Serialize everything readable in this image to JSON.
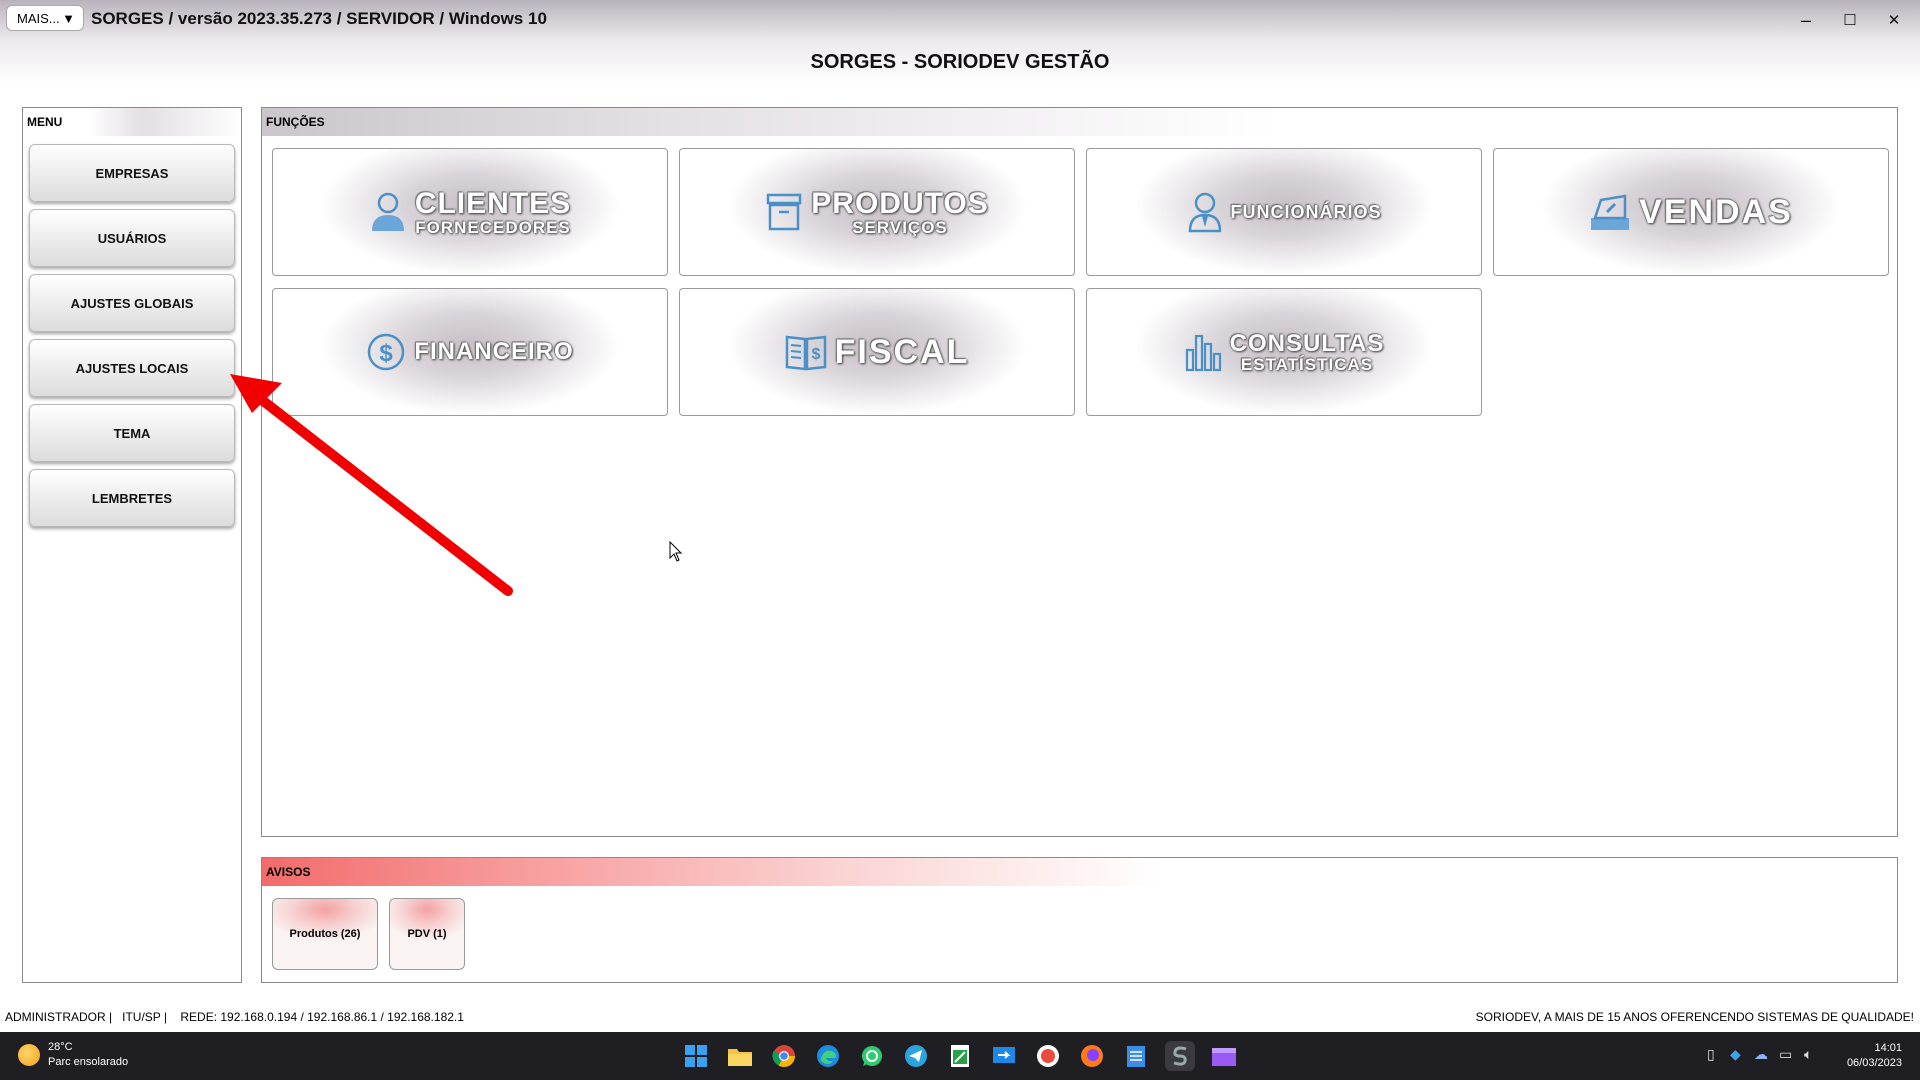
{
  "titlebar": {
    "mais_label": "MAIS...",
    "mais_arrow": "▼",
    "window_title": "SORGES / versão 2023.35.273 / SERVIDOR / Windows 10",
    "minimize": "–",
    "maximize": "☐",
    "close": "✕"
  },
  "app_title": "SORGES - SORIODEV GESTÃO",
  "menu": {
    "header": "MENU",
    "items": [
      {
        "label": "EMPRESAS"
      },
      {
        "label": "USUÁRIOS"
      },
      {
        "label": "AJUSTES GLOBAIS"
      },
      {
        "label": "AJUSTES LOCAIS"
      },
      {
        "label": "TEMA"
      },
      {
        "label": "LEMBRETES"
      }
    ]
  },
  "funcoes": {
    "header": "FUNÇÕES",
    "tiles": [
      {
        "title": "CLIENTES",
        "subtitle": "FORNECEDORES",
        "icon": "person-icon"
      },
      {
        "title": "PRODUTOS",
        "subtitle": "SERVIÇOS",
        "icon": "box-icon"
      },
      {
        "title": "FUNCIONÁRIOS",
        "subtitle": "",
        "icon": "employee-icon"
      },
      {
        "title": "VENDAS",
        "subtitle": "",
        "icon": "cash-register-icon"
      },
      {
        "title": "FINANCEIRO",
        "subtitle": "",
        "icon": "dollar-icon"
      },
      {
        "title": "FISCAL",
        "subtitle": "",
        "icon": "fiscal-book-icon"
      },
      {
        "title": "CONSULTAS",
        "subtitle": "ESTATÍSTICAS",
        "icon": "bar-chart-icon"
      }
    ]
  },
  "avisos": {
    "header": "AVISOS",
    "items": [
      {
        "label": "Produtos (26)"
      },
      {
        "label": "PDV (1)"
      }
    ]
  },
  "statusbar": {
    "left": "ADMINISTRADOR |   ITU/SP |    REDE: 192.168.0.194 / 192.168.86.1 / 192.168.182.1",
    "right": "SORIODEV, A MAIS DE 15 ANOS OFERENCENDO SISTEMAS DE QUALIDADE!"
  },
  "taskbar": {
    "weather_temp": "28°C",
    "weather_desc": "Parc ensolarado",
    "time": "14:01",
    "date": "06/03/2023",
    "apps": [
      "windows-start-icon",
      "file-explorer-icon",
      "chrome-icon",
      "edge-icon",
      "whatsapp-icon",
      "telegram-icon",
      "spreadsheet-icon",
      "remote-icon",
      "app-icon",
      "firefox-icon",
      "notepad-icon",
      "sorges-icon",
      "media-icon"
    ]
  },
  "colors": {
    "accent_icon": "#4a90c8",
    "aviso_red": "#f26b6b",
    "arrow_red": "#f00000"
  }
}
